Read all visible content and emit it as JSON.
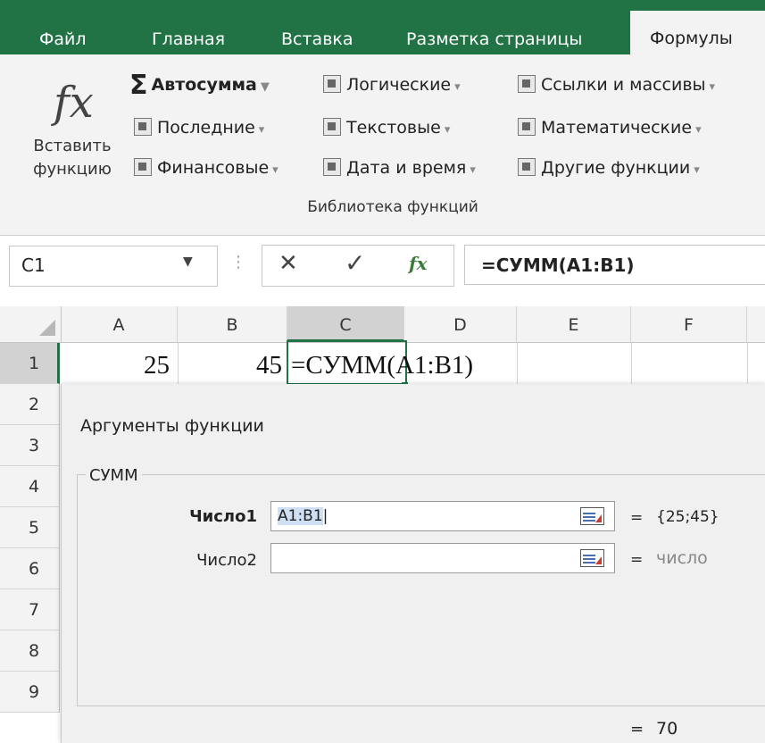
{
  "ribbon_tabs": [
    "Файл",
    "Главная",
    "Вставка",
    "Разметка страницы",
    "Формулы"
  ],
  "active_tab": "Формулы",
  "ribbon": {
    "insert_function": {
      "icon": "fx-icon",
      "label_line1": "Вставить",
      "label_line2": "функцию"
    },
    "col1": [
      {
        "label": "Автосумма",
        "icon": "sigma-icon"
      },
      {
        "label": "Последние",
        "icon": "star-icon"
      },
      {
        "label": "Финансовые",
        "icon": "finance-icon"
      }
    ],
    "col2": [
      {
        "label": "Логические",
        "icon": "question-icon"
      },
      {
        "label": "Текстовые",
        "icon": "text-icon"
      },
      {
        "label": "Дата и время",
        "icon": "clock-icon"
      }
    ],
    "col3": [
      {
        "label": "Ссылки и массивы",
        "icon": "search-icon"
      },
      {
        "label": "Математические",
        "icon": "theta-icon"
      },
      {
        "label": "Другие функции",
        "icon": "more-icon"
      }
    ],
    "group_label": "Библиотека функций"
  },
  "formula_bar": {
    "name_box": "C1",
    "formula": "=СУММ(A1:B1)"
  },
  "grid": {
    "columns": [
      "A",
      "B",
      "C",
      "D",
      "E",
      "F"
    ],
    "rows": [
      "1",
      "2",
      "3",
      "4",
      "5",
      "6",
      "7",
      "8",
      "9"
    ],
    "cells": {
      "A1": "25",
      "B1": "45",
      "C1": "=СУММ(A1:B1)"
    }
  },
  "dialog": {
    "title": "Аргументы функции",
    "function_name": "СУММ",
    "args": [
      {
        "label": "Число1",
        "value": "A1:B1",
        "equals": "=",
        "result": "{25;45}"
      },
      {
        "label": "Число2",
        "value": "",
        "equals": "=",
        "result": "число"
      }
    ],
    "result_equals": "=",
    "result": "70"
  },
  "colors": {
    "excel_green": "#217346",
    "ribbon_bg": "#f3f3f3",
    "dialog_bg": "#f0f0f0"
  }
}
